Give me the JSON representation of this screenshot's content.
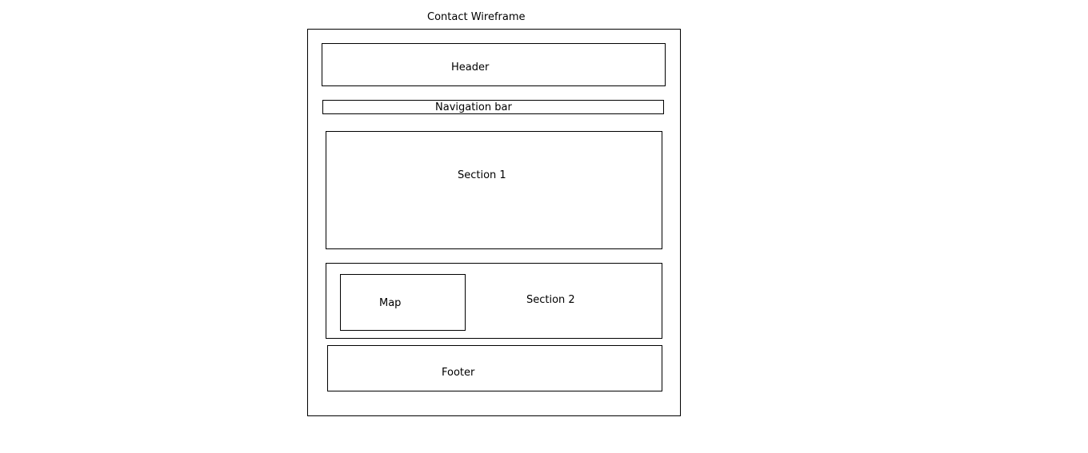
{
  "diagram": {
    "title": "Contact Wireframe",
    "blocks": {
      "header": "Header",
      "navigation": "Navigation bar",
      "section1": "Section 1",
      "section2": "Section 2",
      "map": "Map",
      "footer": "Footer"
    }
  }
}
